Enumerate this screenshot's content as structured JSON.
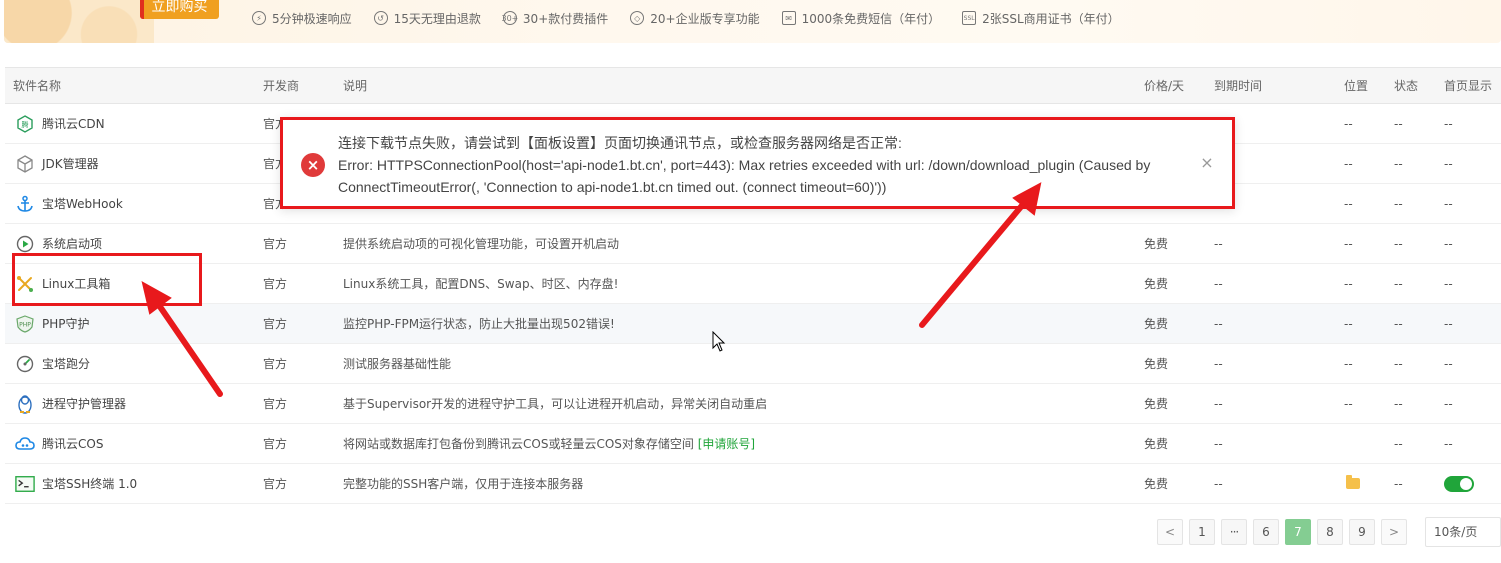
{
  "banner": {
    "buy_label": "立即购买",
    "perks": [
      {
        "icon": "lightning-clock-icon",
        "label": "5分钟极速响应"
      },
      {
        "icon": "refund-icon",
        "label": "15天无理由退款"
      },
      {
        "icon": "plugin-30-icon",
        "icon_text": "30+",
        "label": "30+款付费插件"
      },
      {
        "icon": "diamond-icon",
        "label": "20+企业版专享功能"
      },
      {
        "icon": "mail-icon",
        "label": "1000条免费短信（年付）"
      },
      {
        "icon": "ssl-shield-icon",
        "icon_text": "SSL",
        "label": "2张SSL商用证书（年付）"
      }
    ]
  },
  "table": {
    "headers": {
      "name": "软件名称",
      "developer": "开发商",
      "description": "说明",
      "price": "价格/天",
      "expire": "到期时间",
      "position": "位置",
      "status": "状态",
      "home": "首页显示"
    },
    "rows": [
      {
        "icon": "tencent-cdn-icon",
        "name": "腾讯云CDN",
        "developer": "官方",
        "description": "",
        "price": "",
        "expire": "",
        "position": "--",
        "status": "--",
        "home": "--"
      },
      {
        "icon": "jdk-cube-icon",
        "name": "JDK管理器",
        "developer": "官方",
        "description": "",
        "price": "",
        "expire": "",
        "position": "--",
        "status": "--",
        "home": "--"
      },
      {
        "icon": "anchor-icon",
        "name": "宝塔WebHook",
        "developer": "官方",
        "description": "",
        "price": "",
        "expire": "",
        "position": "--",
        "status": "--",
        "home": "--"
      },
      {
        "icon": "play-circle-icon",
        "name": "系统启动项",
        "developer": "官方",
        "description": "提供系统启动项的可视化管理功能，可设置开机启动",
        "price": "免费",
        "expire": "--",
        "position": "--",
        "status": "--",
        "home": "--"
      },
      {
        "icon": "tools-icon",
        "name": "Linux工具箱",
        "developer": "官方",
        "description": "Linux系统工具，配置DNS、Swap、时区、内存盘!",
        "price": "免费",
        "expire": "--",
        "position": "--",
        "status": "--",
        "home": "--"
      },
      {
        "icon": "php-shield-icon",
        "name": "PHP守护",
        "developer": "官方",
        "description": "监控PHP-FPM运行状态，防止大批量出现502错误!",
        "price": "免费",
        "expire": "--",
        "position": "--",
        "status": "--",
        "home": "--"
      },
      {
        "icon": "gauge-icon",
        "name": "宝塔跑分",
        "developer": "官方",
        "description": "测试服务器基础性能",
        "price": "免费",
        "expire": "--",
        "position": "--",
        "status": "--",
        "home": "--"
      },
      {
        "icon": "penguin-icon",
        "name": "进程守护管理器",
        "developer": "官方",
        "description": "基于Supervisor开发的进程守护工具，可以让进程开机启动，异常关闭自动重启",
        "price": "免费",
        "expire": "--",
        "position": "--",
        "status": "--",
        "home": "--"
      },
      {
        "icon": "tencent-cos-icon",
        "name": "腾讯云COS",
        "developer": "官方",
        "description": "将网站或数据库打包备份到腾讯云COS或轻量云COS对象存储空间",
        "link": "[申请账号]",
        "price": "免费",
        "expire": "--",
        "position": "",
        "status": "--",
        "home": "--"
      },
      {
        "icon": "terminal-icon",
        "name": "宝塔SSH终端 1.0",
        "developer": "官方",
        "description": "完整功能的SSH客户端，仅用于连接本服务器",
        "price": "免费",
        "expire": "--",
        "position": "folder",
        "status": "--",
        "home": "toggle-on"
      }
    ]
  },
  "pagination": {
    "prev": "<",
    "pages": [
      "1",
      "···",
      "6",
      "7",
      "8",
      "9"
    ],
    "current": "7",
    "next": ">",
    "per_page": "10条/页"
  },
  "error_toast": {
    "icon_text": "×",
    "line1": "连接下载节点失败，请尝试到【面板设置】页面切换通讯节点，或检查服务器网络是否正常:",
    "line2": "Error: HTTPSConnectionPool(host='api-node1.bt.cn', port=443): Max retries exceeded with url: /down/download_plugin (Caused by ConnectTimeoutError(, 'Connection to api-node1.bt.cn timed out. (connect timeout=60)'))",
    "close": "×"
  },
  "colors": {
    "accent_green": "#20a53a",
    "error_red": "#e03a3a",
    "annotation_red": "#e8191c",
    "buy_orange": "#f0a020"
  }
}
